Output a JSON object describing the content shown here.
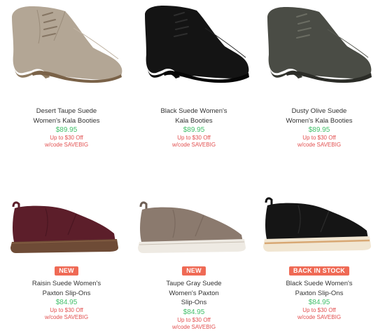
{
  "accent_colors": {
    "price": "#43c06b",
    "promo": "#e24f4f",
    "badge": "#ef6a55"
  },
  "products": [
    {
      "image": "shoe-photo",
      "color": "#b3a695",
      "badge": "",
      "name_line1": "Desert Taupe Suede",
      "name_line2": "Women's Kala Booties",
      "name_line3": "",
      "price": "$89.95",
      "promo_line1": "Up to $30 Off",
      "promo_line2": "w/code SAVEBIG"
    },
    {
      "image": "shoe-photo",
      "color": "#141414",
      "badge": "",
      "name_line1": "Black Suede Women's",
      "name_line2": "Kala Booties",
      "name_line3": "",
      "price": "$89.95",
      "promo_line1": "Up to $30 Off",
      "promo_line2": "w/code SAVEBIG"
    },
    {
      "image": "shoe-photo",
      "color": "#4a4c45",
      "badge": "",
      "name_line1": "Dusty Olive Suede",
      "name_line2": "Women's Kala Booties",
      "name_line3": "",
      "price": "$89.95",
      "promo_line1": "Up to $30 Off",
      "promo_line2": "w/code SAVEBIG"
    },
    {
      "image": "shoe-photo",
      "color": "#5c1e2a",
      "badge": "NEW",
      "name_line1": "Raisin Suede Women's",
      "name_line2": "Paxton Slip-Ons",
      "name_line3": "",
      "price": "$84.95",
      "promo_line1": "Up to $30 Off",
      "promo_line2": "w/code SAVEBIG"
    },
    {
      "image": "shoe-photo",
      "color": "#8b7a6e",
      "badge": "NEW",
      "name_line1": "Taupe Gray Suede",
      "name_line2": "Women's Paxton",
      "name_line3": "Slip-Ons",
      "price": "$84.95",
      "promo_line1": "Up to $30 Off",
      "promo_line2": "w/code SAVEBIG"
    },
    {
      "image": "shoe-photo",
      "color": "#151515",
      "badge": "BACK IN STOCK",
      "name_line1": "Black Suede Women's",
      "name_line2": "Paxton Slip-Ons",
      "name_line3": "",
      "price": "$84.95",
      "promo_line1": "Up to $30 Off",
      "promo_line2": "w/code SAVEBIG"
    }
  ]
}
